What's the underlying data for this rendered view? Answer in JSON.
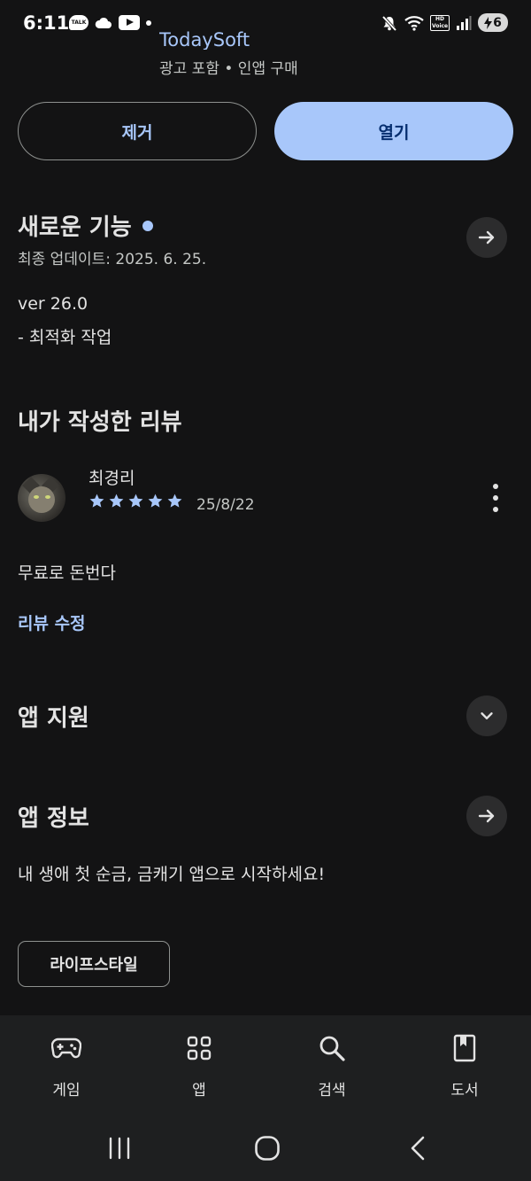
{
  "status_bar": {
    "time": "6:11",
    "talk_badge": "TALK",
    "hd_label": "HD Voice",
    "battery": "6"
  },
  "header": {
    "developer": "TodaySoft",
    "meta": "광고 포함 • 인앱 구매"
  },
  "actions": {
    "remove_label": "제거",
    "open_label": "열기",
    "accent_color": "#a8c7fa"
  },
  "whats_new": {
    "title": "새로운 기능",
    "last_updated": "최종 업데이트: 2025. 6. 25.",
    "version": "ver 26.0",
    "notes": "- 최적화 작업"
  },
  "my_review": {
    "title": "내가 작성한 리뷰",
    "reviewer": "최경리",
    "rating": 5,
    "date": "25/8/22",
    "text": "무료로 돈번다",
    "edit_label": "리뷰 수정"
  },
  "app_support": {
    "title": "앱 지원"
  },
  "app_info": {
    "title": "앱 정보",
    "description": "내 생애 첫 순금, 금캐기 앱으로 시작하세요!",
    "category": "라이프스타일"
  },
  "bottom_nav": {
    "items": [
      {
        "label": "게임",
        "icon": "gamepad-icon"
      },
      {
        "label": "앱",
        "icon": "apps-grid-icon"
      },
      {
        "label": "검색",
        "icon": "search-icon"
      },
      {
        "label": "도서",
        "icon": "book-icon"
      }
    ]
  },
  "system_nav": {
    "items": [
      "recents-icon",
      "home-icon",
      "back-icon"
    ]
  }
}
